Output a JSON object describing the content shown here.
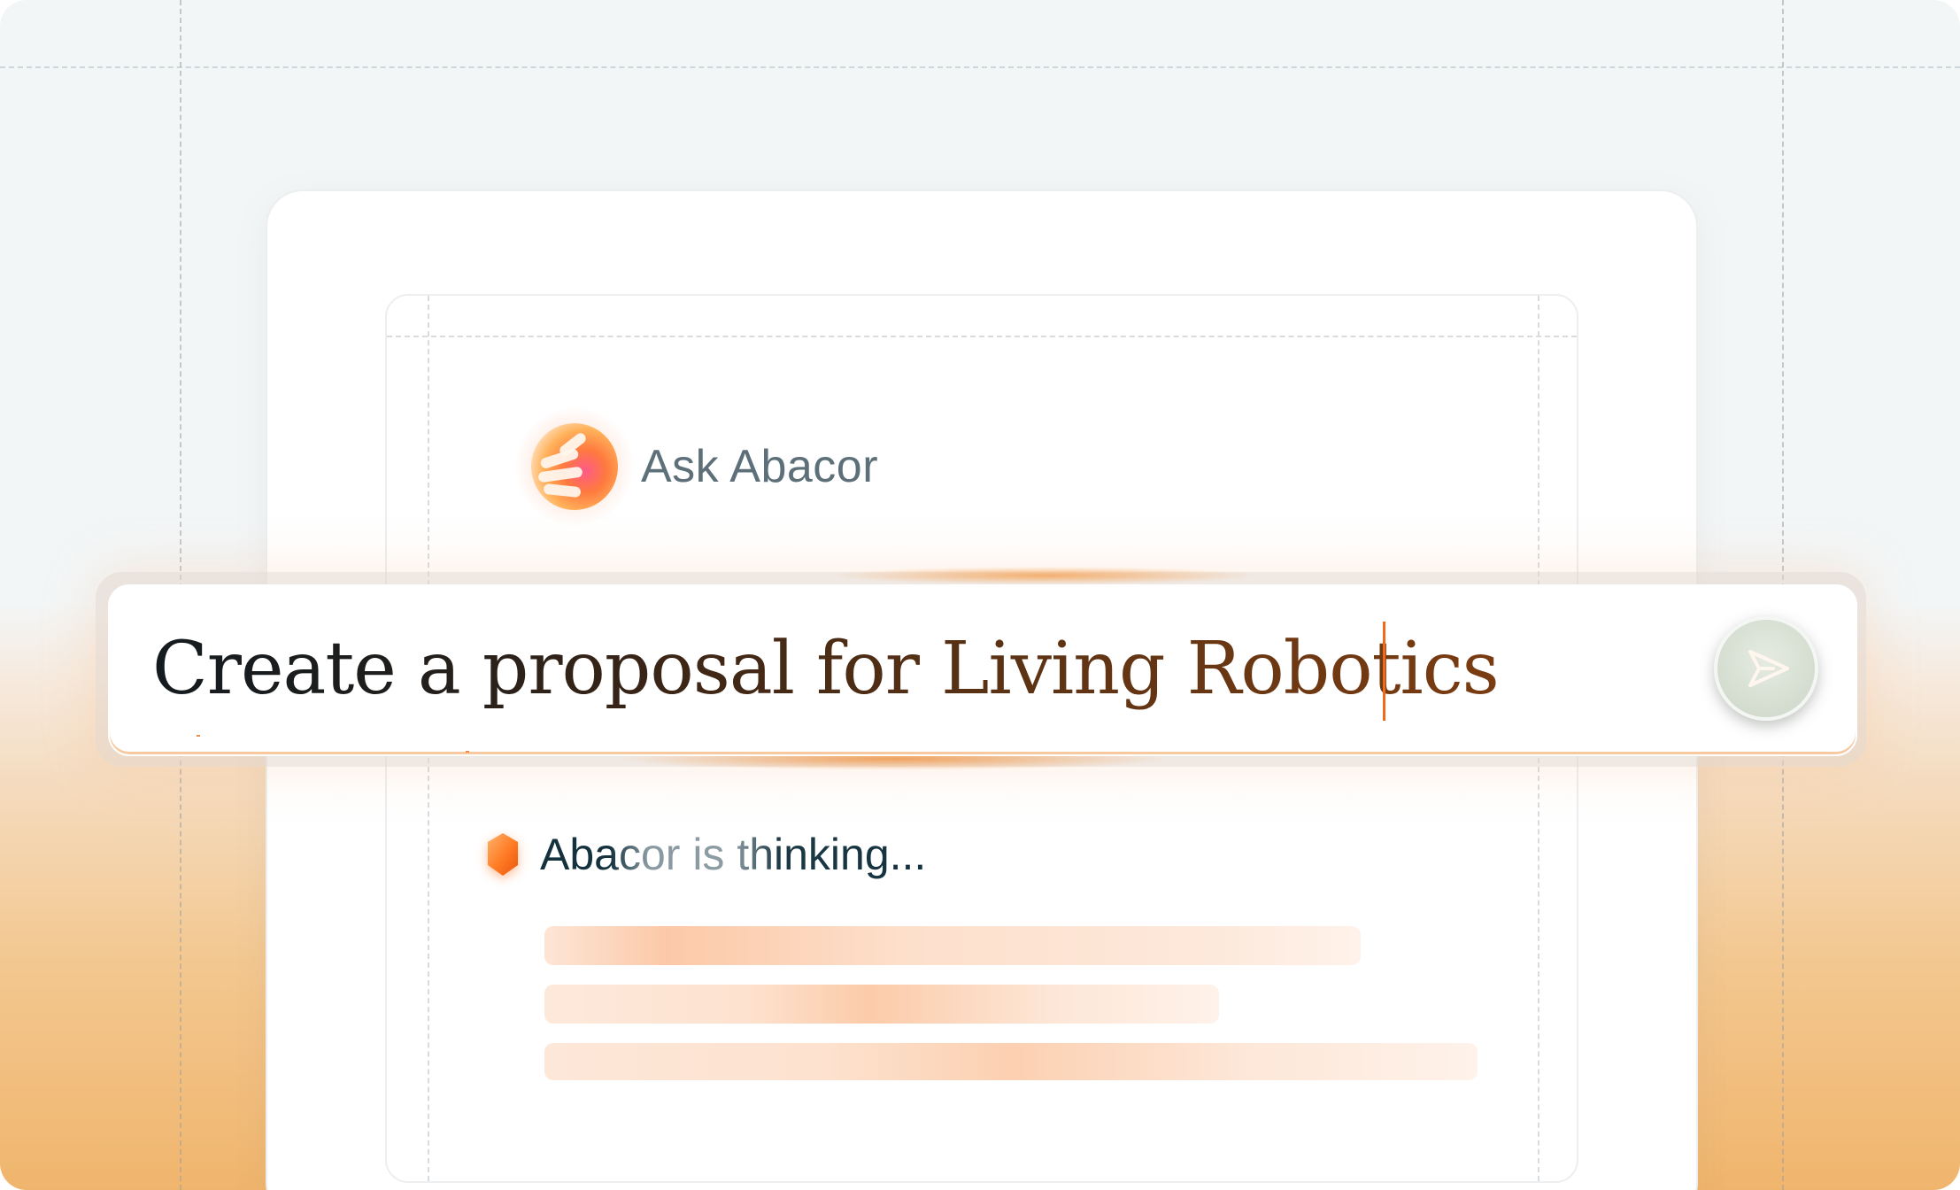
{
  "header": {
    "title": "Ask Abacor",
    "logo_icon": "abacor-orb-icon"
  },
  "prompt": {
    "value": "Create a proposal for Living Robotics",
    "send_icon": "send-icon",
    "caret_color": "#ef6a1a"
  },
  "status": {
    "icon": "hexagon-icon",
    "text": "Abacor is thinking..."
  },
  "colors": {
    "accent": "#ef6a1a",
    "background_top": "#f3f6f7",
    "background_bottom": "#f0b56d",
    "skeleton": "#fcc9a8",
    "ask_label": "#5d6f78",
    "thinking_text": "#14313e"
  }
}
